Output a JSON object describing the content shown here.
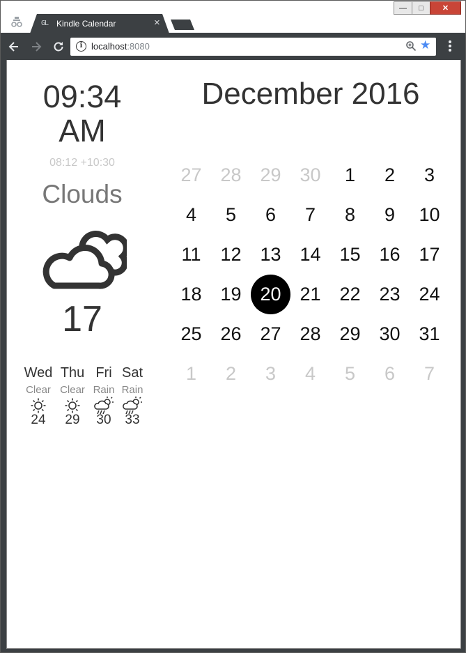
{
  "browser": {
    "tab_favicon": "GL",
    "tab_title": "Kindle Calendar",
    "tab_close": "×",
    "ghost_tab_text": "",
    "url_host": "localhost",
    "url_port": ":8080",
    "window_controls": {
      "minimize": "—",
      "maximize": "□",
      "close": "✕"
    },
    "colors": {
      "chrome": "#3c4043",
      "close_button": "#c94537",
      "star": "#4a8af4"
    },
    "icons": [
      "back-arrow-icon",
      "forward-arrow-icon",
      "reload-icon",
      "info-icon",
      "zoom-icon",
      "star-icon",
      "menu-icon",
      "profile-icon"
    ]
  },
  "clock": {
    "time": "09:34",
    "period": "AM",
    "sub": "08:12 +10:30"
  },
  "weather": {
    "condition": "Clouds",
    "icon": "clouds-icon",
    "temperature": "17",
    "forecast": [
      {
        "day": "Wed",
        "condition": "Clear",
        "icon": "sun-icon",
        "temp": "24"
      },
      {
        "day": "Thu",
        "condition": "Clear",
        "icon": "sun-icon",
        "temp": "29"
      },
      {
        "day": "Fri",
        "condition": "Rain",
        "icon": "rain-icon",
        "temp": "30"
      },
      {
        "day": "Sat",
        "condition": "Rain",
        "icon": "rain-icon",
        "temp": "33"
      }
    ]
  },
  "calendar": {
    "title": "December 2016",
    "today": "20",
    "today_color": "#000000",
    "muted_color": "#c8c8c8",
    "weeks": [
      [
        {
          "d": "27",
          "m": true
        },
        {
          "d": "28",
          "m": true
        },
        {
          "d": "29",
          "m": true
        },
        {
          "d": "30",
          "m": true
        },
        {
          "d": "1"
        },
        {
          "d": "2"
        },
        {
          "d": "3"
        }
      ],
      [
        {
          "d": "4"
        },
        {
          "d": "5"
        },
        {
          "d": "6"
        },
        {
          "d": "7"
        },
        {
          "d": "8"
        },
        {
          "d": "9"
        },
        {
          "d": "10"
        }
      ],
      [
        {
          "d": "11"
        },
        {
          "d": "12"
        },
        {
          "d": "13"
        },
        {
          "d": "14"
        },
        {
          "d": "15"
        },
        {
          "d": "16"
        },
        {
          "d": "17"
        }
      ],
      [
        {
          "d": "18"
        },
        {
          "d": "19"
        },
        {
          "d": "20",
          "t": true
        },
        {
          "d": "21"
        },
        {
          "d": "22"
        },
        {
          "d": "23"
        },
        {
          "d": "24"
        }
      ],
      [
        {
          "d": "25"
        },
        {
          "d": "26"
        },
        {
          "d": "27"
        },
        {
          "d": "28"
        },
        {
          "d": "29"
        },
        {
          "d": "30"
        },
        {
          "d": "31"
        }
      ],
      [
        {
          "d": "1",
          "m": true
        },
        {
          "d": "2",
          "m": true
        },
        {
          "d": "3",
          "m": true
        },
        {
          "d": "4",
          "m": true
        },
        {
          "d": "5",
          "m": true
        },
        {
          "d": "6",
          "m": true
        },
        {
          "d": "7",
          "m": true
        }
      ]
    ]
  }
}
